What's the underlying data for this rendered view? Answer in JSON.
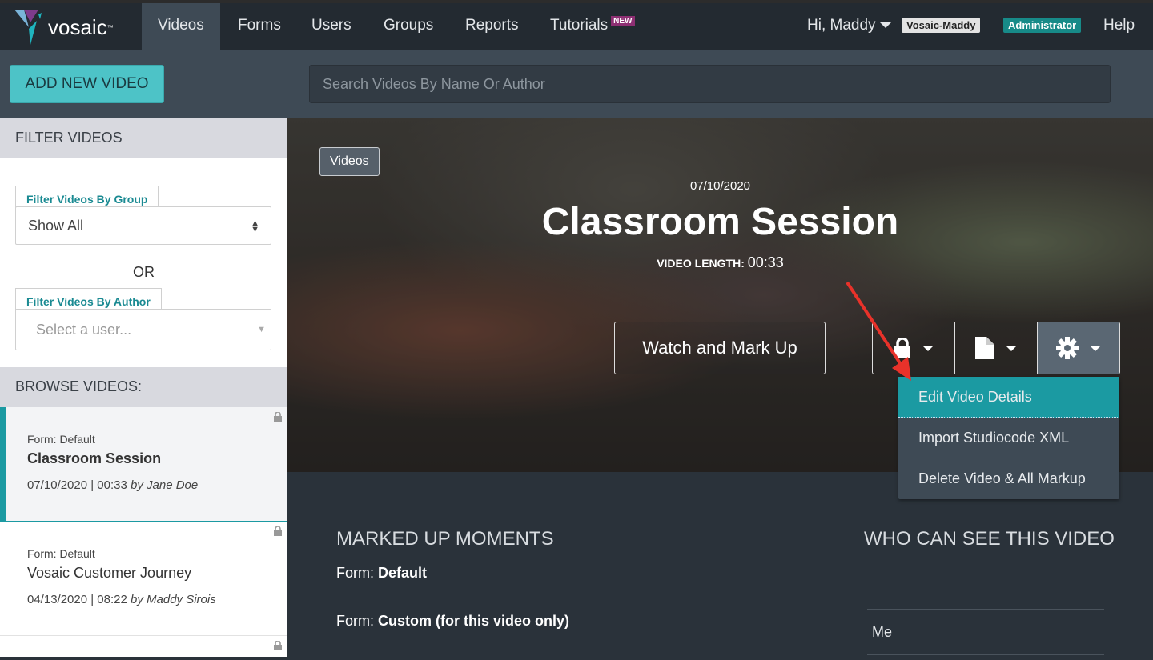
{
  "nav": {
    "brand": "vosaic",
    "trademark": "™",
    "items": [
      {
        "label": "Videos",
        "active": true
      },
      {
        "label": "Forms"
      },
      {
        "label": "Users"
      },
      {
        "label": "Groups"
      },
      {
        "label": "Reports"
      },
      {
        "label": "Tutorials",
        "badge": "NEW"
      }
    ],
    "greeting": "Hi, Maddy",
    "org": "Vosaic-Maddy",
    "role": "Administrator",
    "help": "Help"
  },
  "toolbar": {
    "add_label": "ADD NEW VIDEO",
    "search_placeholder": "Search Videos By Name Or Author"
  },
  "sidebar": {
    "filter_header": "FILTER VIDEOS",
    "group_label": "Filter Videos By Group",
    "group_value": "Show All",
    "or": "OR",
    "author_label": "Filter Videos By Author",
    "author_placeholder": "Select a user...",
    "browse_header": "BROWSE VIDEOS:",
    "videos": [
      {
        "form": "Form: Default",
        "title": "Classroom Session",
        "date": "07/10/2020 | 00:33",
        "author": "by Jane Doe",
        "selected": true
      },
      {
        "form": "Form: Default",
        "title": "Vosaic Customer Journey",
        "date": "04/13/2020 | 08:22",
        "author": "by Maddy Sirois"
      }
    ]
  },
  "video": {
    "breadcrumb": "Videos",
    "date": "07/10/2020",
    "title": "Classroom Session",
    "length_label": "VIDEO LENGTH:",
    "length": "00:33",
    "watch_label": "Watch and Mark Up"
  },
  "menu": {
    "items": [
      "Edit Video Details",
      "Import Studiocode XML",
      "Delete Video & All Markup"
    ],
    "highlighted": "Edit Video Details"
  },
  "details": {
    "moments_header": "MARKED UP MOMENTS",
    "form_prefix": "Form:",
    "form1": "Default",
    "form2": "Custom (for this video only)",
    "who_header": "WHO CAN SEE THIS VIDEO",
    "who": [
      "Me"
    ]
  },
  "colors": {
    "accent": "#1b9aa2",
    "nav": "#232a31",
    "add_button": "#4dc3c7",
    "new_badge": "#8e2f73",
    "annotation_arrow": "#e8322a"
  }
}
